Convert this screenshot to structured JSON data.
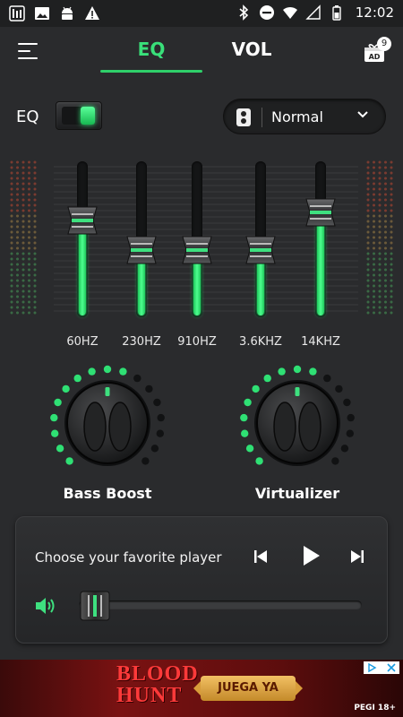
{
  "status_bar": {
    "time": "12:02",
    "left_icons": [
      "equalizer-notification-icon",
      "image-icon",
      "android-icon",
      "warning-icon"
    ],
    "right_icons": [
      "bluetooth-icon",
      "do-not-disturb-icon",
      "wifi-icon",
      "signal-icon",
      "battery-icon"
    ]
  },
  "header": {
    "tabs": [
      {
        "label": "EQ",
        "active": true
      },
      {
        "label": "VOL",
        "active": false
      }
    ],
    "ad_gift_badge": "9",
    "ad_gift_text": "AD"
  },
  "eq": {
    "label": "EQ",
    "enabled": true,
    "preset": "Normal"
  },
  "bands": [
    {
      "label": "60HZ",
      "level": 0.62
    },
    {
      "label": "230HZ",
      "level": 0.43
    },
    {
      "label": "910HZ",
      "level": 0.43
    },
    {
      "label": "3.6KHZ",
      "level": 0.43
    },
    {
      "label": "14KHZ",
      "level": 0.67
    }
  ],
  "knobs": [
    {
      "label": "Bass Boost",
      "lit_dots": 10,
      "total_dots": 17
    },
    {
      "label": "Virtualizer",
      "lit_dots": 10,
      "total_dots": 17
    }
  ],
  "player": {
    "title": "Choose your favorite player",
    "volume": 0.06
  },
  "ad": {
    "line1": "BLOOD",
    "line2": "HUNT",
    "cta": "JUEGA YA",
    "rating": "PEGI 18+"
  },
  "colors": {
    "accent": "#2fd06a",
    "background": "#2a2b2d"
  }
}
